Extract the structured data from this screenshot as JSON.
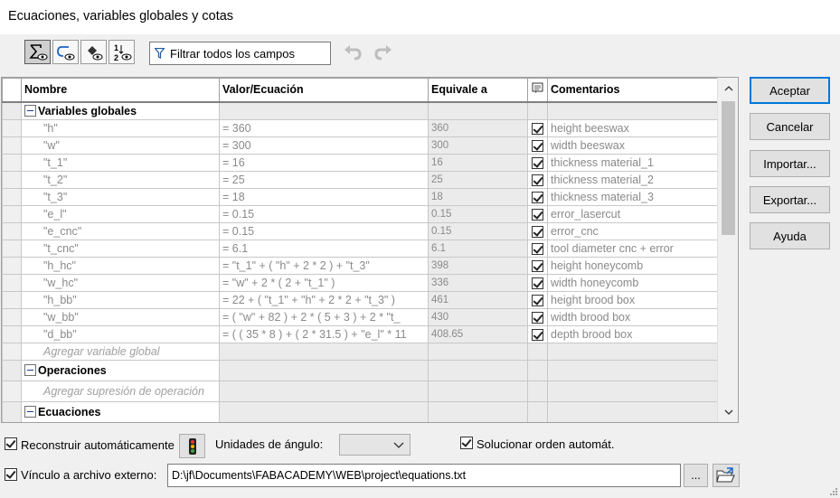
{
  "window": {
    "title": "Ecuaciones, variables globales y cotas"
  },
  "toolbar": {
    "filter_label": "Filtrar todos los campos",
    "buttons": [
      "equations-view",
      "sketch-equation-view",
      "dimension-view",
      "ordered-view"
    ]
  },
  "grid": {
    "headers": {
      "name": "Nombre",
      "value": "Valor/Ecuación",
      "evaluates": "Equivale a",
      "comments": "Comentarios"
    },
    "sections": {
      "globals": "Variables globales",
      "operations": "Operaciones",
      "equations": "Ecuaciones"
    },
    "rows": [
      {
        "name": "\"h\"",
        "value": "= 360",
        "evaluates": "360",
        "comment": "height beeswax"
      },
      {
        "name": "\"w\"",
        "value": "= 300",
        "evaluates": "300",
        "comment": "width beeswax"
      },
      {
        "name": "\"t_1\"",
        "value": "= 16",
        "evaluates": "16",
        "comment": "thickness material_1"
      },
      {
        "name": "\"t_2\"",
        "value": "= 25",
        "evaluates": "25",
        "comment": "thickness material_2"
      },
      {
        "name": "\"t_3\"",
        "value": "= 18",
        "evaluates": "18",
        "comment": "thickness material_3"
      },
      {
        "name": "\"e_l\"",
        "value": "= 0.15",
        "evaluates": "0.15",
        "comment": "error_lasercut"
      },
      {
        "name": "\"e_cnc\"",
        "value": "= 0.15",
        "evaluates": "0.15",
        "comment": "error_cnc"
      },
      {
        "name": "\"t_cnc\"",
        "value": "= 6.1",
        "evaluates": "6.1",
        "comment": "tool diameter cnc + error"
      },
      {
        "name": "\"h_hc\"",
        "value": "= \"t_1\" + ( \"h\" + 2 * 2 ) + \"t_3\"",
        "evaluates": "398",
        "comment": "height honeycomb"
      },
      {
        "name": "\"w_hc\"",
        "value": "= \"w\" + 2 * ( 2 + \"t_1\" )",
        "evaluates": "336",
        "comment": "width honeycomb"
      },
      {
        "name": "\"h_bb\"",
        "value": "= 22 + ( \"t_1\" + \"h\" + 2 * 2 + \"t_3\" )",
        "evaluates": "461",
        "comment": "height brood box"
      },
      {
        "name": "\"w_bb\"",
        "value": "= ( \"w\" + 82 ) + 2 * ( 5 + 3 ) + 2 * \"t_",
        "evaluates": "430",
        "comment": "width brood box"
      },
      {
        "name": "\"d_bb\"",
        "value": "= ( ( 35 * 8 ) + ( 2 * 31.5 ) + \"e_l\" * 11",
        "evaluates": "408.65",
        "comment": "depth brood box"
      }
    ],
    "add_global": "Agregar variable global",
    "add_operation": "Agregar supresión de operación"
  },
  "buttons": {
    "accept": "Aceptar",
    "cancel": "Cancelar",
    "import": "Importar...",
    "export": "Exportar...",
    "help": "Ayuda"
  },
  "bottom": {
    "auto_rebuild": "Reconstruir automáticamente",
    "angle_units": "Unidades de ángulo:",
    "angle_units_value": "",
    "auto_order": "Solucionar orden automát.",
    "link_label": "Vínculo a archivo externo:",
    "link_path": "D:\\jf\\Documents\\FABACADEMY\\WEB\\project\\equations.txt",
    "browse": "..."
  },
  "colors": {
    "accent": "#0078d7",
    "muted_text": "#8a8a8a",
    "filler": "#ebebeb"
  }
}
